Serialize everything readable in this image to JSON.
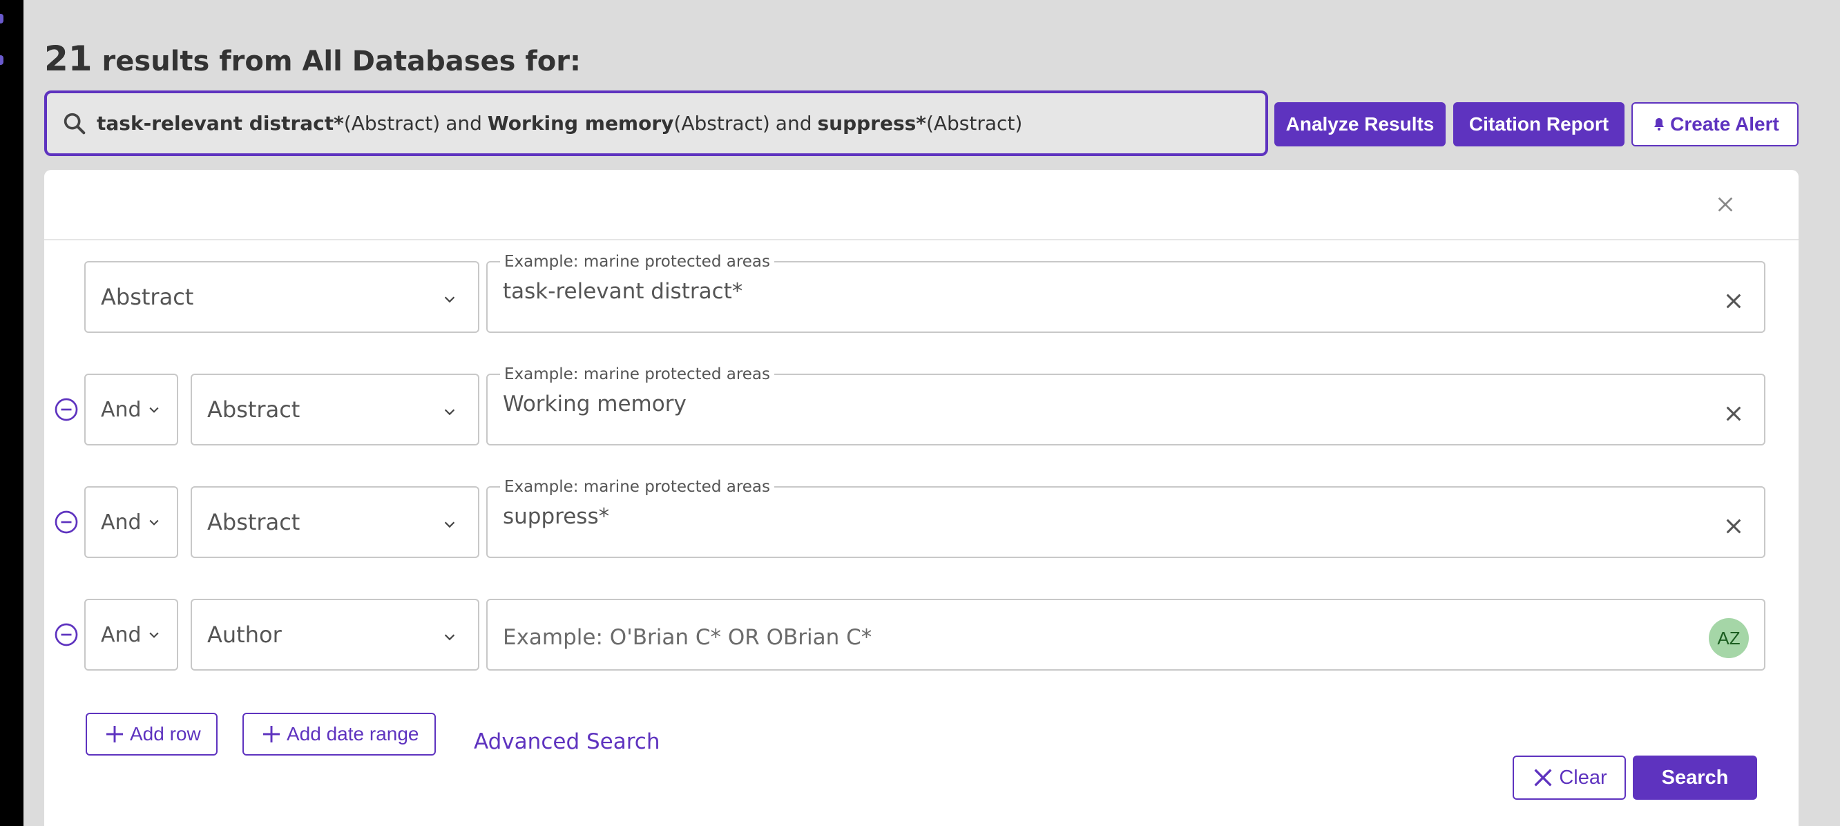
{
  "header": {
    "result_count": "21",
    "results_text": "results from All Databases for:"
  },
  "query": {
    "parts": [
      {
        "term": "task-relevant distract*",
        "field": "(Abstract)",
        "op": "and"
      },
      {
        "term": "Working memory",
        "field": "(Abstract)",
        "op": "and"
      },
      {
        "term": "suppress*",
        "field": "(Abstract)",
        "op": ""
      }
    ]
  },
  "actions": {
    "analyze": "Analyze Results",
    "citation": "Citation Report",
    "alert": "Create Alert"
  },
  "rows": [
    {
      "bool": "",
      "field": "Abstract",
      "legend": "Example: marine protected areas",
      "value": "task-relevant distract*",
      "placeholder": ""
    },
    {
      "bool": "And",
      "field": "Abstract",
      "legend": "Example: marine protected areas",
      "value": "Working memory",
      "placeholder": ""
    },
    {
      "bool": "And",
      "field": "Abstract",
      "legend": "Example: marine protected areas",
      "value": "suppress*",
      "placeholder": ""
    },
    {
      "bool": "And",
      "field": "Author",
      "legend": "",
      "value": "",
      "placeholder": "Example: O'Brian C* OR OBrian C*"
    }
  ],
  "az_badge": "AZ",
  "footer": {
    "add_row": "Add row",
    "add_date_range": "Add date range",
    "advanced_search": "Advanced Search",
    "clear": "Clear",
    "search": "Search"
  },
  "colors": {
    "accent": "#5e33bf",
    "badge_bg": "#a5d6a7"
  }
}
